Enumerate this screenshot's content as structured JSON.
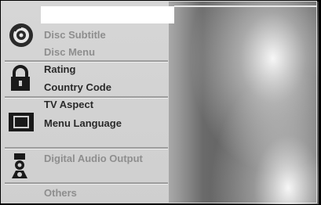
{
  "menu": {
    "groups": [
      {
        "icon": "disc-icon",
        "items": [
          {
            "label": "Disc Subtitle",
            "state": "dim"
          },
          {
            "label": "Disc Menu",
            "state": "dim"
          }
        ]
      },
      {
        "icon": "lock-icon",
        "items": [
          {
            "label": "Rating",
            "state": "active"
          },
          {
            "label": "Country Code",
            "state": "active"
          }
        ]
      },
      {
        "icon": "tv-aspect-icon",
        "items": [
          {
            "label": "TV Aspect",
            "state": "active"
          },
          {
            "label": "Menu Language",
            "state": "active"
          }
        ]
      },
      {
        "icon": "speaker-icon",
        "items": [
          {
            "label": "Digital Audio Output",
            "state": "dim"
          }
        ]
      },
      {
        "icon": "",
        "items": [
          {
            "label": "Others",
            "state": "dim"
          }
        ]
      }
    ]
  }
}
